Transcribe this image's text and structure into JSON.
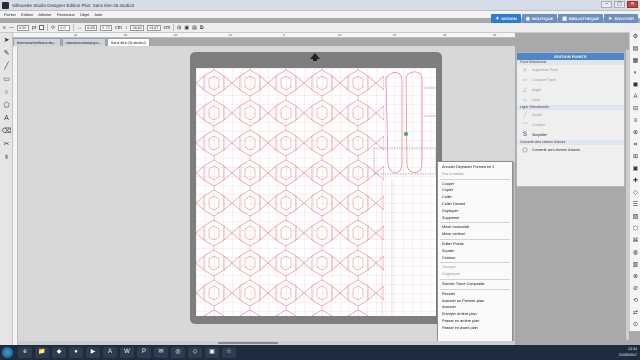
{
  "window": {
    "title": "Silhouette Studio Designer Edition Plus: Sans titre-25.studio3"
  },
  "menu": [
    "Fichier",
    "Edition",
    "Afficher",
    "Panneaux",
    "Objet",
    "Aide"
  ],
  "app_tabs": [
    {
      "label": "DESIGN",
      "icon": "✦"
    },
    {
      "label": "BOUTIQUE",
      "icon": "◉"
    },
    {
      "label": "BIBLIOTHEQUE",
      "icon": "▦"
    },
    {
      "label": "ENVOYER",
      "icon": "➤"
    }
  ],
  "toolbar": {
    "stroke_width": "0.00",
    "pt_unit": "pt",
    "rotation": "0.0",
    "x_value": "6.65",
    "w_value": "2.72",
    "unit": "cm",
    "y_value": "28.62",
    "h_value": "13.87",
    "unit2": "cm"
  },
  "doc_tabs": [
    "femmeacherfleurs.stu...",
    "oiseauxcurlampopu...",
    "Sans titre-25.studio3"
  ],
  "ruler_numbers": [
    "-40",
    "-30",
    "-20",
    "-10",
    "0",
    "10",
    "20",
    "30",
    "40"
  ],
  "context_menu": [
    {
      "label": "Annuler Déplacez Formes en 2",
      "enabled": true
    },
    {
      "label": "Pas à rétablir",
      "enabled": false
    },
    {
      "sep": true
    },
    {
      "label": "Couper",
      "enabled": true
    },
    {
      "label": "Copier",
      "enabled": true
    },
    {
      "label": "Coller",
      "enabled": true
    },
    {
      "label": "Coller Devant",
      "enabled": true
    },
    {
      "label": "Dupliquer",
      "enabled": true
    },
    {
      "label": "Supprimer",
      "enabled": true
    },
    {
      "sep": true
    },
    {
      "label": "Miroir horizontal",
      "enabled": true
    },
    {
      "label": "Miroir vertical",
      "enabled": true
    },
    {
      "sep": true
    },
    {
      "label": "Editer Points",
      "enabled": true
    },
    {
      "label": "Souder",
      "enabled": true
    },
    {
      "label": "Contour",
      "enabled": true
    },
    {
      "sep": true
    },
    {
      "label": "Grouper",
      "enabled": false
    },
    {
      "label": "Dégrouper",
      "enabled": false
    },
    {
      "sep": true
    },
    {
      "label": "Scinder Tracé Composite",
      "enabled": true
    },
    {
      "sep": true
    },
    {
      "label": "Reculer",
      "enabled": true
    },
    {
      "label": "Avancer au Premier-plan",
      "enabled": true
    },
    {
      "label": "Avancer",
      "enabled": true
    },
    {
      "label": "Envoyer Arrière-plan",
      "enabled": true
    },
    {
      "label": "Passer en arrière plan",
      "enabled": true
    },
    {
      "label": "Passer en avant plan",
      "enabled": true
    }
  ],
  "panel": {
    "title": "EDITION POINTS",
    "point_section": "Point Sélectionné",
    "point_buttons": [
      {
        "label": "Supprimer Point",
        "icon": "✕",
        "enabled": false
      },
      {
        "label": "Coupure Tracé",
        "icon": "✂",
        "enabled": false
      },
      {
        "label": "Angle",
        "icon": "∠",
        "enabled": false
      },
      {
        "label": "Lisse",
        "icon": "∿",
        "enabled": false
      }
    ],
    "line_section": "Ligne Sélectionnée",
    "line_buttons": [
      {
        "label": "Aplatir",
        "icon": "╱",
        "enabled": false
      },
      {
        "label": "Courber",
        "icon": "⌒",
        "enabled": false
      },
      {
        "label": "Simplifier",
        "icon": "S",
        "enabled": true
      }
    ],
    "convert_section": "Convertir vers chemin d'accès",
    "convert_buttons": [
      {
        "label": "Convertir vers chemin d'accès",
        "icon": "⬠",
        "enabled": true
      }
    ]
  },
  "tools_left": [
    "pointer-icon",
    "pencil-icon",
    "line-icon",
    "rectangle-icon",
    "ellipse-icon",
    "polygon-icon",
    "text-icon",
    "eraser-icon",
    "knife-icon",
    "eyedropper-icon"
  ],
  "tools_left_glyphs": [
    "➤",
    "✎",
    "╱",
    "▭",
    "○",
    "⬠",
    "A",
    "⌫",
    "✂",
    "⌽"
  ],
  "tools_right_glyphs": [
    "⚙",
    "▤",
    "▦",
    "◐",
    "◼",
    "A",
    "⊟",
    "≡",
    "⊕",
    "⌗",
    "⊞",
    "▣",
    "✚",
    "◇",
    "☰",
    "▧",
    "⬡",
    "⌘",
    "◍",
    "▥",
    "⊗",
    "⊘",
    "⟲",
    "⇄",
    "⊙"
  ],
  "taskbar": {
    "apps": [
      "e",
      "📁",
      "◆",
      "●",
      "▶",
      "A",
      "W",
      "P",
      "✉",
      "◎",
      "◇",
      "▣",
      "☆"
    ],
    "time": "13:34",
    "date": "21/05/2017"
  }
}
